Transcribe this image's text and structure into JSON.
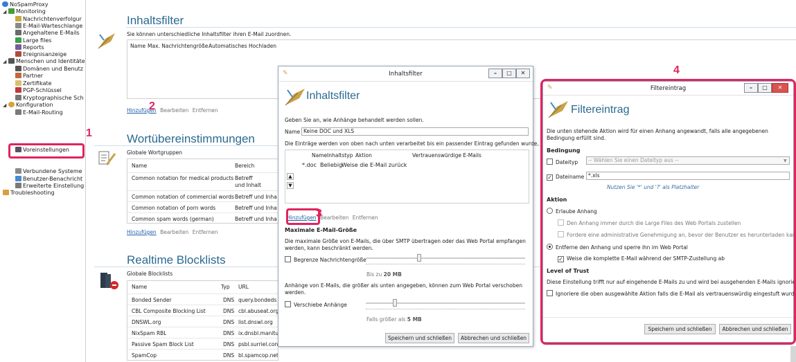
{
  "tree": {
    "root": "NoSpamProxy",
    "monitoring": "Monitoring",
    "monitoring_items": [
      "Nachrichtenverfolgur",
      "E-Mail-Warteschlange",
      "Angehaltene E-Mails",
      "Large files",
      "Reports",
      "Ereignisanzeige"
    ],
    "people": "Menschen und Identitäte",
    "people_items": [
      "Domänen und Benutz",
      "Partner",
      "Zertifikate",
      "PGP-Schlüssel",
      "Kryptographische Sch"
    ],
    "config": "Konfiguration",
    "config_items": [
      "E-Mail-Routing",
      "Voreinstellungen",
      "Verbundene Systeme",
      "Benutzer-Benachricht",
      "Erweiterte Einstellung"
    ],
    "troubleshooting": "Troubleshooting"
  },
  "main": {
    "inhalt_title": "Inhaltsfilter",
    "inhalt_desc": "Sie können unterschiedliche Inhaltsfilter ihren E-Mail zuordnen.",
    "inhalt_cols": [
      "Name",
      "Max. Nachrichtengröße",
      "Automatisches Hochladen"
    ],
    "add": "Hinzufügen",
    "edit": "Bearbeiten",
    "remove": "Entfernen",
    "wort_title": "Wortübereinstimmungen",
    "wort_group": "Globale Wortgruppen",
    "wort_cols": [
      "Name",
      "Bereich"
    ],
    "wort_rows": [
      {
        "name": "Common notation for medical products",
        "area": "Betreff und Inhalt"
      },
      {
        "name": "Common notation of commercial words",
        "area": "Betreff und Inha"
      },
      {
        "name": "Common notation of porn words",
        "area": "Betreff und Inha"
      },
      {
        "name": "Common spam words (german)",
        "area": "Betreff und Inha"
      }
    ],
    "rbl_title": "Realtime Blocklists",
    "rbl_group": "Globale Blocklists",
    "rbl_cols": [
      "Name",
      "Typ",
      "URL"
    ],
    "rbl_rows": [
      {
        "name": "Bonded Sender",
        "type": "DNS",
        "url": "query.bondeds"
      },
      {
        "name": "CBL Composite Blocking List",
        "type": "DNS",
        "url": "cbl.abuseat.org"
      },
      {
        "name": "DNSWL.org",
        "type": "DNS",
        "url": "list.dnswl.org"
      },
      {
        "name": "NixSpam RBL",
        "type": "DNS",
        "url": "ix.dnsbl.manitu"
      },
      {
        "name": "Passive Spam Block List",
        "type": "DNS",
        "url": "psbl.surriel.con"
      },
      {
        "name": "SpamCop",
        "type": "DNS",
        "url": "bl.spamcop.net"
      }
    ]
  },
  "dlg1": {
    "window_title": "Inhaltsfilter",
    "heading": "Inhaltsfilter",
    "intro": "Geben Sie an, wie Anhänge behandelt werden sollen.",
    "name_label": "Name",
    "name_value": "Keine DOC und XLS",
    "order_text": "Die Einträge werden von oben nach unten verarbeitet bis ein passender Eintrag gefunden wurde.",
    "cols": [
      "Name",
      "Inhaltstyp",
      "Aktion",
      "Vertrauenswürdige E-Mails"
    ],
    "row": {
      "name": "*.doc",
      "type": "Beliebig",
      "action": "Weise die E-Mail zurück"
    },
    "add": "Hinzufügen",
    "edit": "Bearbeiten",
    "remove": "Entfernen",
    "max_title": "Maximale E-Mail-Größe",
    "max_desc": "Die maximale Größe von E-Mails, die über SMTP übertragen oder das Web Portal empfangen werden, kann beschränkt werden.",
    "limit_label": "Begrenze Nachrichtengröße",
    "limit_value_prefix": "Bis zu",
    "limit_value": "20 MB",
    "move_desc": "Anhänge von E-Mails, die größer als unten angegeben, können zum Web Portal verschoben werden.",
    "move_label": "Verschiebe Anhänge",
    "move_value_prefix": "Falls größer als",
    "move_value": "5 MB",
    "save": "Speichern und schließen",
    "cancel": "Abbrechen und schließen"
  },
  "dlg2": {
    "window_title": "Filtereintrag",
    "heading": "Filtereintrag",
    "intro": "Die unten stehende Aktion wird für einen Anhang angewandt, falls alle angegebenen Bedingung erfüllt sind.",
    "cond_title": "Bedingung",
    "filetype_label": "Dateityp",
    "filetype_placeholder": "-- Wählen Sie einen Dateityp aus --",
    "filename_label": "Dateiname",
    "filename_value": "*.xls",
    "hint": "Nutzen Sie '*' und '?' als Platzhalter",
    "action_title": "Aktion",
    "allow": "Erlaube Anhang",
    "allow_sub1": "Den Anhang immer durch die Large Files des Web Portals zustellen",
    "allow_sub2": "Fordere eine administrative Genehmigung an, bevor der Benutzer es herunterladen kann",
    "remove": "Entferne den Anhang und sperre ihn im Web Portal",
    "remove_sub": "Weise die komplette E-Mail während der SMTP-Zustellung ab",
    "trust_title": "Level of Trust",
    "trust_desc": "Diese Einstellung trifft nur auf eingehende E-Mails zu und wird bei ausgehenden E-Mails ignoriert.",
    "trust_label": "Ignoriere die oben ausgewählte Aktion falls die E-Mail als vertrauenswürdig eingestuft wurde",
    "save": "Speichern und schließen",
    "cancel": "Abbrechen und schließen"
  },
  "markers": [
    "1",
    "2",
    "3",
    "4"
  ],
  "colors": {
    "accent": "#e0245e",
    "heading": "#2a6a92",
    "link": "#1f5fa8"
  }
}
